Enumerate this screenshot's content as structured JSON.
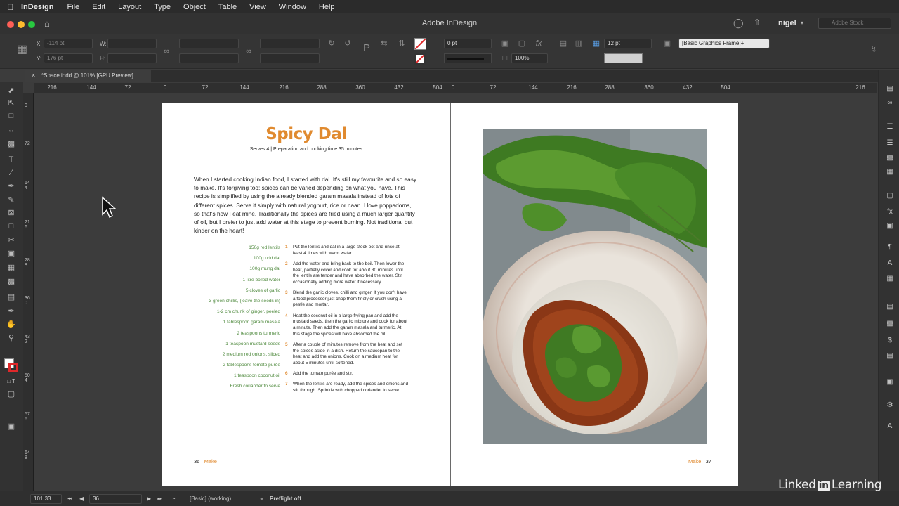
{
  "menubar": {
    "app_name": "InDesign",
    "items": [
      "File",
      "Edit",
      "Layout",
      "Type",
      "Object",
      "Table",
      "View",
      "Window",
      "Help"
    ]
  },
  "titlebar": {
    "title": "Adobe InDesign",
    "user": "nigel",
    "search_placeholder": "Adobe Stock"
  },
  "control": {
    "x_label": "X:",
    "y_label": "Y:",
    "w_label": "W:",
    "h_label": "H:",
    "x_value": "-114 pt",
    "y_value": "176 pt",
    "stroke_weight": "0 pt",
    "opacity": "100%",
    "gap": "12 pt",
    "object_style": "[Basic Graphics Frame]+"
  },
  "document": {
    "tab_label": "*Space.indd @ 101% [GPU Preview]"
  },
  "ruler": {
    "h_ticks": [
      "216",
      "144",
      "72",
      "0",
      "72",
      "144",
      "216",
      "288",
      "360",
      "432",
      "504",
      "0",
      "72",
      "144",
      "216",
      "288",
      "360",
      "432",
      "504",
      "216"
    ],
    "v_ticks": [
      "0",
      "72",
      "144",
      "216",
      "288",
      "360",
      "432",
      "504",
      "576",
      "648"
    ]
  },
  "recipe": {
    "title": "Spicy Dal",
    "serves": "Serves 4 | Preparation and cooking time 35 minutes",
    "intro": "When I started cooking Indian food, I started with dal. It's still my favourite and so easy to make. It's forgiving too: spices can be varied depending on what you have. This recipe is simplified by using the already blended garam masala instead of lots of different spices. Serve it simply with natural yoghurt, rice or naan. I love poppadoms, so that's how I eat mine. Traditionally the spices are fried using a much larger quantity of oil, but I prefer to just add water at this stage to prevent burning. Not traditional but kinder on the heart!",
    "ingredients": [
      "150g red lentils",
      "100g urid dal",
      "100g mung dal",
      "1 litre boiled water",
      "5 cloves of garlic",
      "3 green chillis, (leave the seeds in)",
      "1-2 cm chunk of ginger, peeled",
      "1 tablespoon garam masala",
      "2 teaspoons turmeric",
      "1 teaspoon mustard seeds",
      "2 medium red onions, sliced",
      "2 tablespoons tomato purée",
      "1 teaspoon coconut oil",
      "Fresh coriander to serve"
    ],
    "steps": [
      {
        "n": "1",
        "text": "Put the lentils and dal in a large stock pot and rinse at least 4 times with warm water"
      },
      {
        "n": "2",
        "text": "Add the water and bring back to the boil. Then lower the heat, partially cover and cook for about 30 minutes until the lentils are tender and have absorbed the water. Stir occasionally adding more water if necessary."
      },
      {
        "n": "3",
        "text": "Blend the garlic cloves, chilli and ginger. If you don't have a food processor just chop them finely or crush using a pestle and mortar."
      },
      {
        "n": "4",
        "text": "Heat the coconut oil in a large frying pan and add the mustard seeds, then the garlic mixture and cook for about a minute. Then add the garam masala and turmeric. At this stage the spices will have absorbed the oil."
      },
      {
        "n": "5",
        "text": "After a couple of minutes remove from the heat and set the spices aside in a dish. Return the saucepan to the heat and add the onions. Cook on a medium heat for about 5 minutes until softened."
      },
      {
        "n": "6",
        "text": "Add the tomato purée and stir."
      },
      {
        "n": "7",
        "text": "When the lentils are ready, add the spices and onions and stir through. Sprinkle with chopped coriander to serve."
      }
    ],
    "left_folio": {
      "num": "36",
      "section": "Make"
    },
    "right_folio": {
      "num": "37",
      "section": "Make"
    }
  },
  "status": {
    "zoom": "101.33",
    "page": "36",
    "style": "[Basic] (working)",
    "preflight": "Preflight off"
  },
  "watermark": {
    "pre": "Linked",
    "in": "in",
    "post": "Learning"
  },
  "colors": {
    "accent": "#e08a2f",
    "ingredient_green": "#4f8a3e",
    "ui_bg": "#3c3c3c"
  }
}
